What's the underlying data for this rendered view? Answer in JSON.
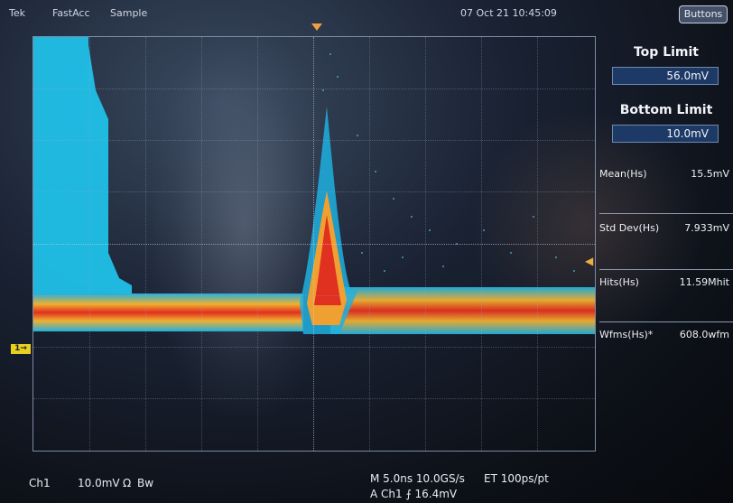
{
  "header": {
    "brand": "Tek",
    "mode": "FastAcc",
    "acq": "Sample",
    "datetime": "07 Oct 21 10:45:09",
    "buttons_label": "Buttons"
  },
  "panel": {
    "top_limit_title": "Top Limit",
    "top_limit_value": "56.0mV",
    "bottom_limit_title": "Bottom Limit",
    "bottom_limit_value": "10.0mV",
    "measurements": [
      {
        "label": "Mean(Hs)",
        "value": "15.5mV"
      },
      {
        "label": "Std Dev(Hs)",
        "value": "7.933mV"
      },
      {
        "label": "Hits(Hs)",
        "value": "11.59Mhit"
      },
      {
        "label": "Wfms(Hs)*",
        "value": "608.0wfm"
      }
    ]
  },
  "markers": {
    "ch1": "1"
  },
  "footer": {
    "channel": "Ch1",
    "scale": "10.0mV",
    "coupling": "Ω",
    "bw": "Bw",
    "timebase": "M 5.0ns 10.0GS/s",
    "et": "ET 100ps/pt",
    "trigger": "A  Ch1  ⨍  16.4mV"
  },
  "colors": {
    "trace_core": "#e03020",
    "trace_mid": "#f0a030",
    "trace_outer": "#1fb0e0",
    "histogram": "#20c0e8",
    "limit_box": "#1d3a66"
  }
}
